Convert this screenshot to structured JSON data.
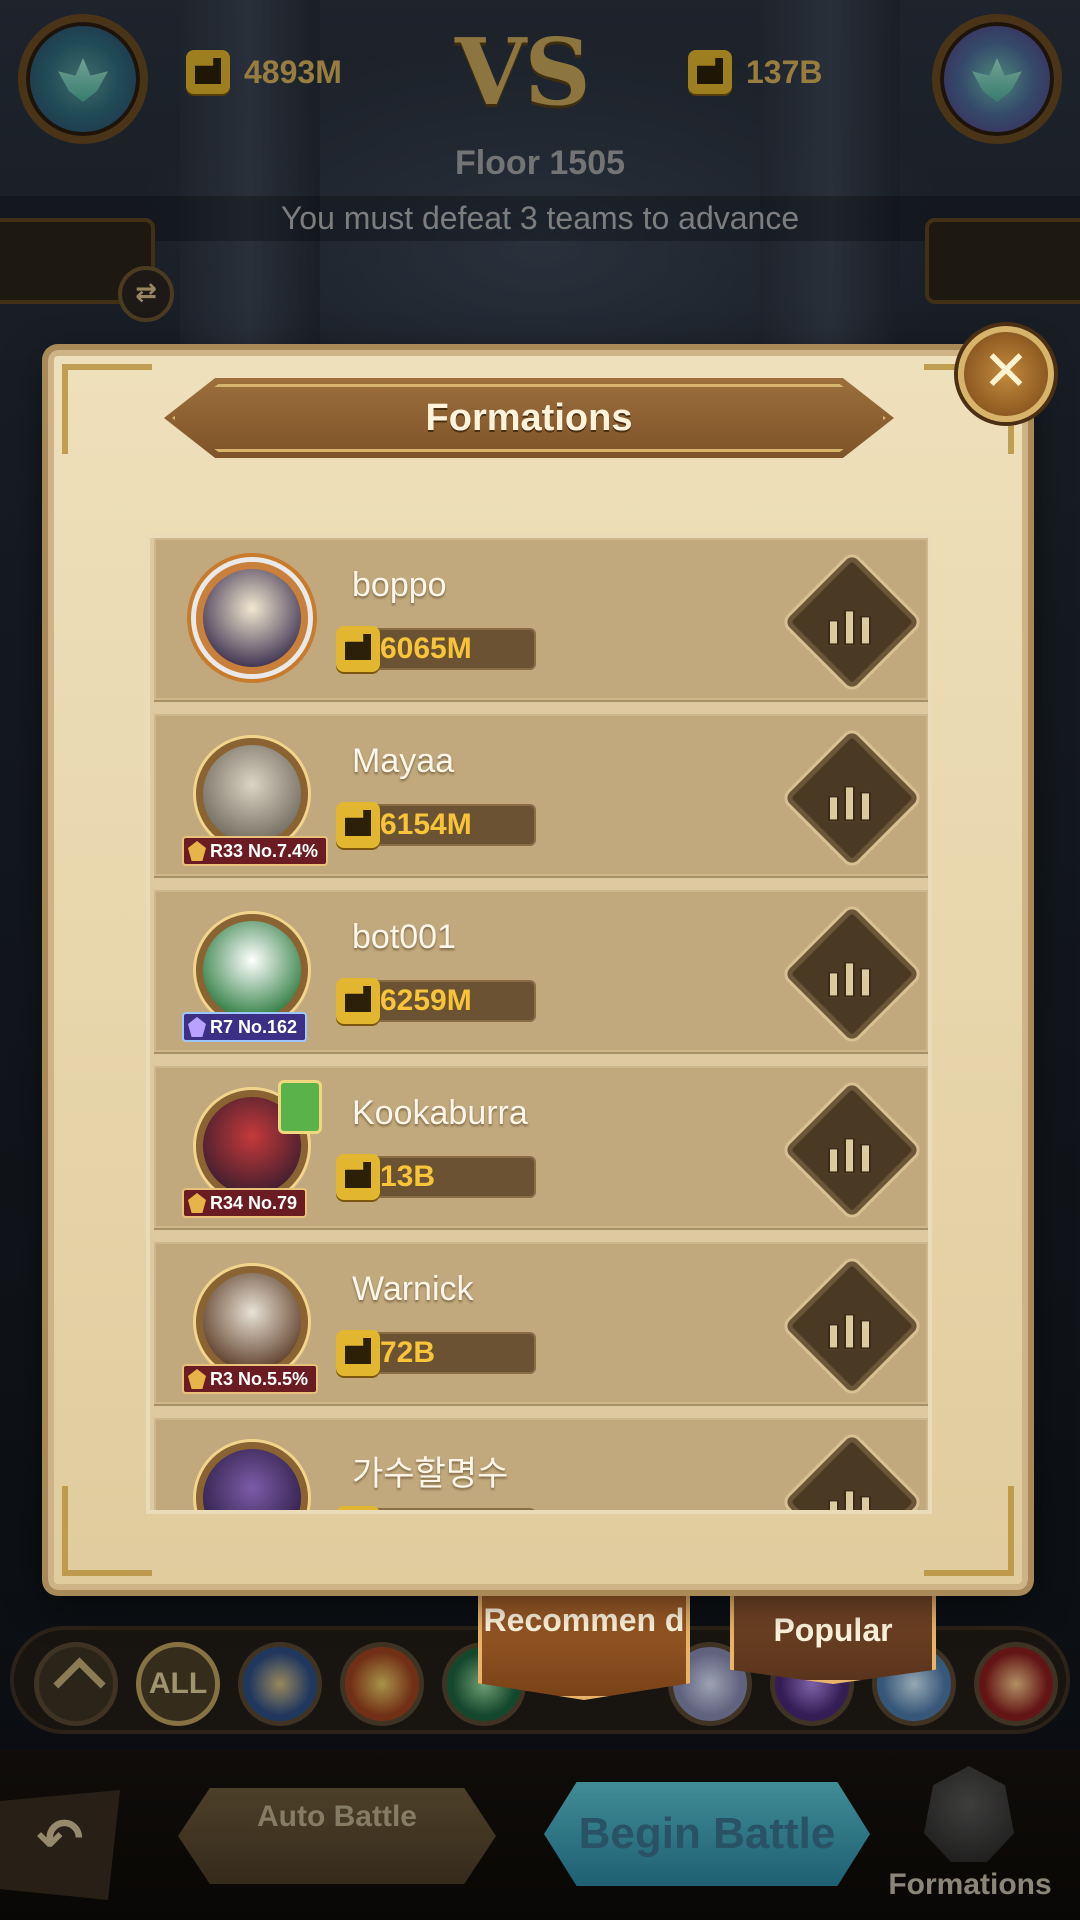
{
  "header": {
    "left_power": "4893M",
    "vs": "VS",
    "right_power": "137B",
    "floor": "Floor 1505",
    "requirement": "You must defeat 3 teams to advance"
  },
  "panel": {
    "title": "Formations",
    "close_glyph": "✕",
    "rows": [
      {
        "name": "boppo",
        "power": "6065M",
        "rank": "",
        "avatar_colors": [
          "#f3e8d0",
          "#3a3050"
        ]
      },
      {
        "name": "Mayaa",
        "power": "6154M",
        "rank": "R33 No.7.4%",
        "avatar_colors": [
          "#dcd4c4",
          "#6f6a5e"
        ]
      },
      {
        "name": "bot001",
        "power": "6259M",
        "rank": "R7 No.162",
        "avatar_colors": [
          "#ffffff",
          "#2a7a3e"
        ]
      },
      {
        "name": "Kookaburra",
        "power": "13B",
        "rank": "R34 No.79",
        "avatar_colors": [
          "#c53a3a",
          "#3c1d2e"
        ]
      },
      {
        "name": "Warnick",
        "power": "72B",
        "rank": "R3 No.5.5%",
        "avatar_colors": [
          "#e8e2d6",
          "#5b3b26"
        ]
      },
      {
        "name": "가수할명수",
        "power": "",
        "rank": "",
        "avatar_colors": [
          "#7c5ca8",
          "#2c1c44"
        ]
      }
    ]
  },
  "tabs": {
    "recommend": "Recommen d",
    "popular": "Popular"
  },
  "filters": {
    "all_label": "ALL"
  },
  "bottom": {
    "back_glyph": "↶",
    "auto_battle": "Auto Battle",
    "begin_battle": "Begin Battle",
    "formations": "Formations"
  },
  "colors": {
    "accent_gold": "#f7c43a",
    "panel_bg": "#e8d6ac",
    "row_bg": "#c2a87d",
    "begin_battle": "#5dc9d6"
  }
}
